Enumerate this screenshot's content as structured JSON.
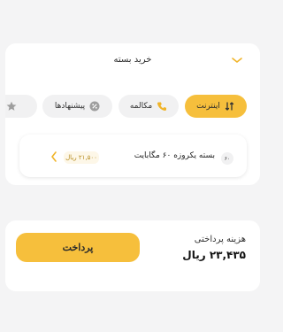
{
  "header": {
    "title": "خرید بسته"
  },
  "tabs": [
    {
      "label": "اینترنت",
      "icon": "internet-icon",
      "active": true
    },
    {
      "label": "مکالمه",
      "icon": "phone-icon",
      "active": false
    },
    {
      "label": "پیشنهادها",
      "icon": "offers-icon",
      "active": false
    },
    {
      "label": "ا",
      "icon": "star-icon",
      "active": false
    }
  ],
  "package": {
    "badge": "۶۰",
    "name": "بسته یکروزه ۶۰ مگابایت",
    "price": "۲۱,۵۰۰ ریال"
  },
  "payment": {
    "label": "هزینه پرداختی",
    "amount": "۲۳,۴۳۵ ریال",
    "button_label": "پرداخت"
  },
  "colors": {
    "accent": "#f6bf3c",
    "background": "#f4f4f5",
    "card": "#ffffff"
  }
}
